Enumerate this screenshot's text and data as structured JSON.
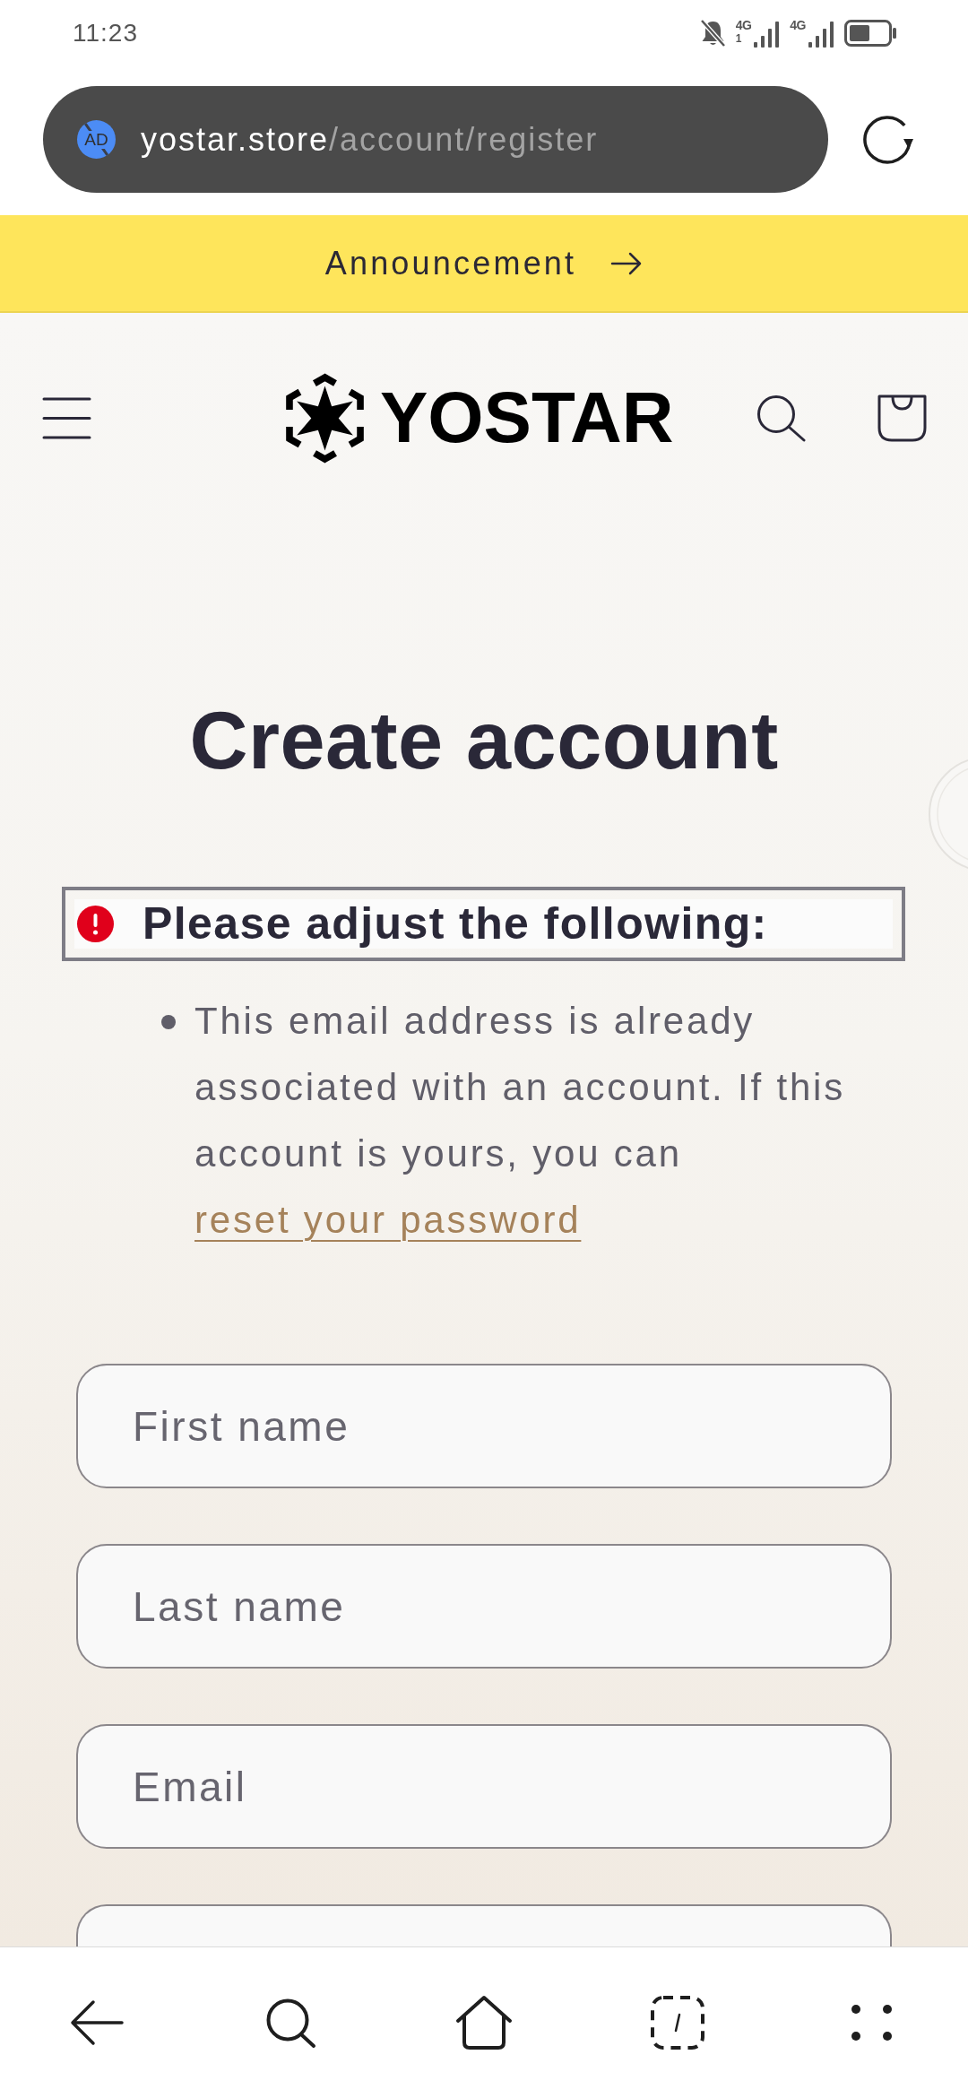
{
  "status_bar": {
    "time": "11:23",
    "networks": [
      {
        "type": "4G",
        "sim": "1"
      },
      {
        "type": "4G"
      }
    ]
  },
  "address_bar": {
    "badge": "AD",
    "host": "yostar.store",
    "path": "/account/register"
  },
  "announcement": {
    "text": "Announcement"
  },
  "header": {
    "logo_text": "YOSTAR"
  },
  "page": {
    "title": "Create account",
    "error_heading": "Please adjust the following:",
    "errors": [
      {
        "text": "This email address is already associated with an account. If this account is yours, you can",
        "link": "reset your password"
      }
    ],
    "fields": [
      {
        "placeholder": "First name"
      },
      {
        "placeholder": "Last name"
      },
      {
        "placeholder": "Email"
      }
    ]
  }
}
